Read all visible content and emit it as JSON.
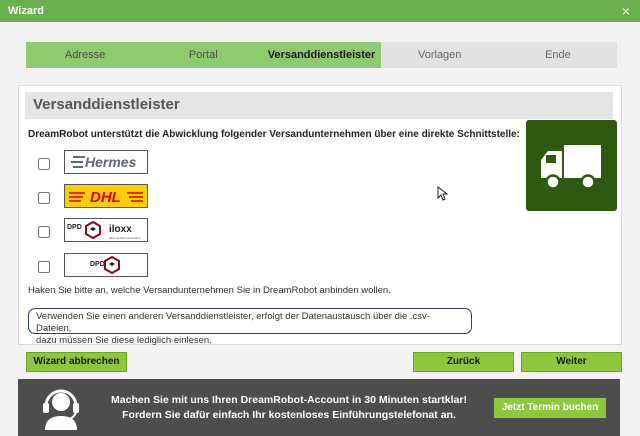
{
  "window": {
    "title": "Wizard",
    "close_label": "×"
  },
  "steps": [
    {
      "label": "Adresse",
      "state": "done"
    },
    {
      "label": "Portal",
      "state": "done"
    },
    {
      "label": "Versanddienstleister",
      "state": "active"
    },
    {
      "label": "Vorlagen",
      "state": "pending"
    },
    {
      "label": "Ende",
      "state": "pending"
    }
  ],
  "panel": {
    "heading": "Versanddienstleister",
    "intro": "DreamRobot unterstützt die Abwicklung folgender Versandunternehmen über eine direkte Schnittstelle:",
    "carriers": [
      {
        "name": "Hermes",
        "logo_text": "Hermes",
        "checked": false
      },
      {
        "name": "DHL",
        "logo_text": "DHL",
        "checked": false
      },
      {
        "name": "DPD / iloxx",
        "logo_text_a": "DPD",
        "logo_text_b": "iloxx",
        "logo_sub": "alles einfach versenden",
        "checked": false
      },
      {
        "name": "DPD",
        "logo_text": "DPD",
        "checked": false
      }
    ],
    "hint": "Haken Sie bitte an, welche Versandunternehmen Sie in DreamRobot anbinden wollen.",
    "note_line1": "Verwenden Sie einen anderen Versanddienstleister, erfolgt der Datenaustausch über die .csv-Dateien,",
    "note_line2": "dazu müssen Sie diese lediglich einlesen.",
    "truck_icon": "truck-icon"
  },
  "buttons": {
    "cancel": "Wizard abbrechen",
    "back": "Zurück",
    "next": "Weiter"
  },
  "banner": {
    "line1": "Machen Sie mit uns Ihren DreamRobot-Account in 30 Minuten startklar!",
    "line2": "Fordern Sie dafür einfach Ihr kostenloses Einführungstelefonat an.",
    "cta": "Jetzt Termin buchen",
    "icon": "support-headset-icon"
  },
  "colors": {
    "accent": "#8dc63f",
    "titlebar": "#6ab04c",
    "truck_bg": "#2d5a0f",
    "banner_bg": "#4d4d4d"
  }
}
